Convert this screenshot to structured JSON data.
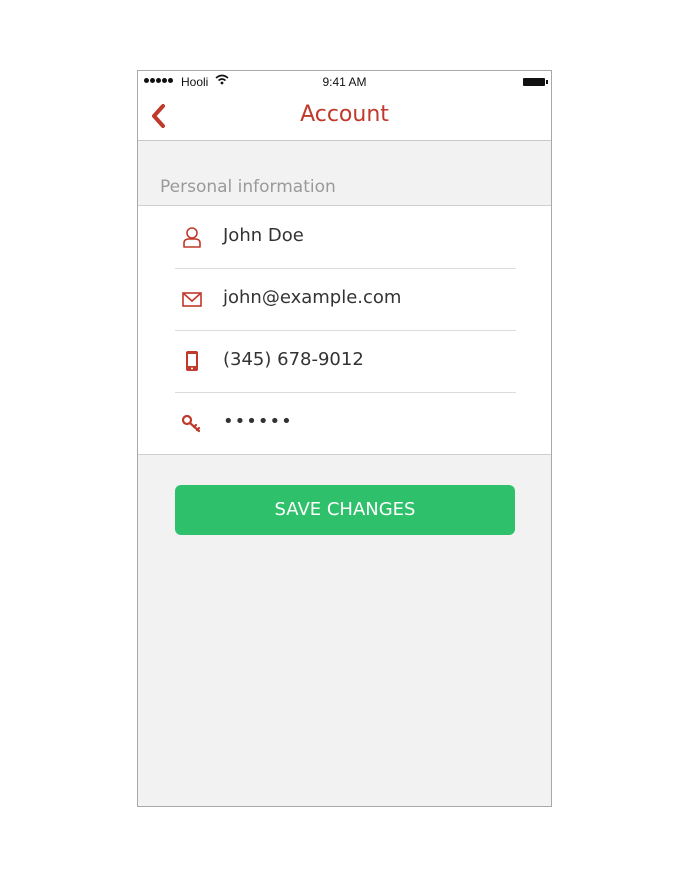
{
  "status_bar": {
    "carrier": "Hooli",
    "time": "9:41 AM",
    "signal_icon": "signal-dots-icon",
    "wifi_icon": "wifi-icon",
    "battery_icon": "battery-icon"
  },
  "nav": {
    "title": "Account",
    "back_icon": "chevron-left-icon"
  },
  "section": {
    "header": "Personal information"
  },
  "fields": [
    {
      "icon": "user-icon",
      "value": "John Doe"
    },
    {
      "icon": "envelope-icon",
      "value": "john@example.com"
    },
    {
      "icon": "phone-icon",
      "value": "(345) 678-9012"
    },
    {
      "icon": "key-icon",
      "value": "••••••"
    }
  ],
  "actions": {
    "save_label": "SAVE CHANGES"
  },
  "colors": {
    "accent": "#c0392b",
    "button": "#2ec06a",
    "background": "#f2f2f2"
  }
}
